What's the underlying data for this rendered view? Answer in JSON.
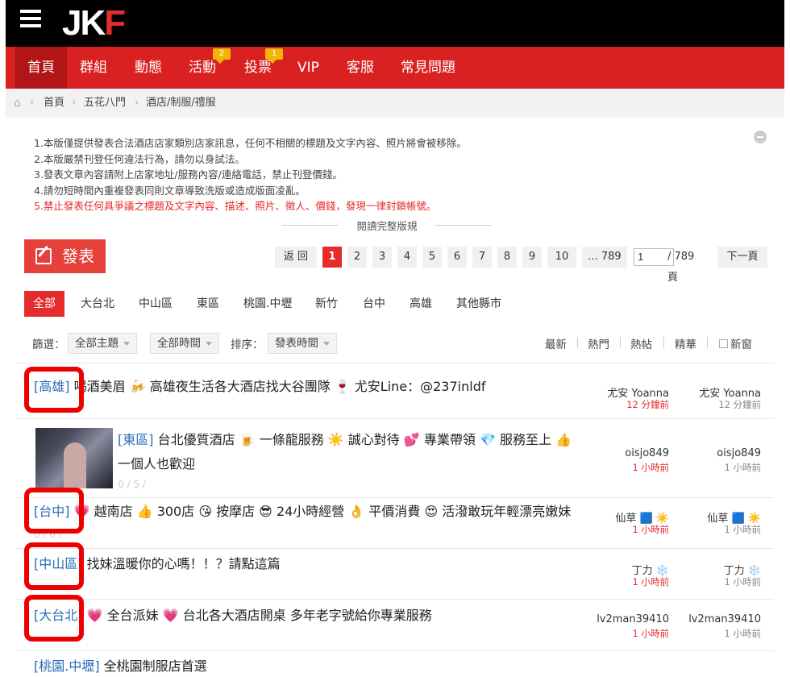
{
  "header": {
    "logo_main": "JK",
    "logo_accent": "F"
  },
  "nav": {
    "items": [
      {
        "label": "首頁",
        "active": true
      },
      {
        "label": "群組"
      },
      {
        "label": "動態"
      },
      {
        "label": "活動",
        "badge": "2"
      },
      {
        "label": "投票",
        "badge": "1"
      },
      {
        "label": "VIP"
      },
      {
        "label": "客服"
      },
      {
        "label": "常見問題"
      }
    ]
  },
  "breadcrumb": {
    "home_icon": "home-icon",
    "items": [
      "首頁",
      "五花八門",
      "酒店/制服/禮服"
    ]
  },
  "rules": {
    "lines": [
      "1.本版僅提供發表合法酒店店家類別店家訊息，任何不相關的標題及文字內容、照片將會被移除。",
      "2.本版嚴禁刊登任何違法行為，請勿以身試法。",
      "3.發表文章內容請附上店家地址/服務內容/連絡電話，禁止刊登價錢。",
      "4.請勿短時間內重複發表同則文章導致洗版或造成版面凌亂。",
      "5.禁止發表任何具爭議之標題及文字內容、描述、照片、徵人、價錢，發現一律封鎖帳號。"
    ],
    "read_full": "閱讀完整版規"
  },
  "post_button": {
    "label": "發表"
  },
  "pagination": {
    "back": "返 回",
    "pages": [
      "1",
      "2",
      "3",
      "4",
      "5",
      "6",
      "7",
      "8",
      "9",
      "10"
    ],
    "active": "1",
    "last": "... 789",
    "current_input": "1",
    "total": "/ 789 頁",
    "next": "下一頁"
  },
  "tabs": {
    "items": [
      "全部",
      "大台北",
      "中山區",
      "東區",
      "桃園.中壢",
      "新竹",
      "台中",
      "高雄",
      "其他縣市"
    ],
    "active": "全部"
  },
  "filters": {
    "filter_label": "篩選：",
    "topic": "全部主題",
    "time": "全部時間",
    "sort_label": "排序：",
    "sort": "發表時間",
    "right": [
      "最新",
      "熱門",
      "熱帖",
      "精華",
      "新窗"
    ]
  },
  "threads": [
    {
      "category": "[高雄]",
      "title": "喝酒美眉 🍻 高雄夜生活各大酒店找大谷團隊 🍷 尤安Line：@237inldf",
      "author": "尤安 Yoanna",
      "time": "12 分鐘前",
      "last_author": "尤安 Yoanna",
      "last_time": "12 分鐘前"
    },
    {
      "category": "[東區]",
      "title": "台北優質酒店 🍺 一條龍服務 ☀️ 誠心對待 💕 專業帶領 💎 服務至上 👍 一個人也歡迎",
      "stats": "0 / 5 /",
      "author": "oisjo849",
      "time": "1 小時前",
      "last_author": "oisjo849",
      "last_time": "1 小時前"
    },
    {
      "category": "[台中]",
      "title": "💗 越南店 👍 300店 😘 按摩店 😎 24小時經營 👌 平價消費 😍 活潑敢玩年輕漂亮嫩妹",
      "stats": "0 / 6 /",
      "author": "仙草 🟦 ☀️",
      "time": "1 小時前",
      "last_author": "仙草 🟦 ☀️",
      "last_time": "1 小時前"
    },
    {
      "category": "[中山區]",
      "title": "找妹溫暖你的心嗎！！？請點這篇",
      "author": "丁力 ❄️",
      "time": "1 小時前",
      "last_author": "丁力 ❄️",
      "last_time": "1 小時前"
    },
    {
      "category": "[大台北]",
      "title": "💗 全台派妹 💗 台北各大酒店開桌 多年老字號給你專業服務",
      "author": "lv2man39410",
      "time": "1 小時前",
      "last_author": "lv2man39410",
      "last_time": "1 小時前"
    },
    {
      "category": "[桃園.中壢]",
      "title": "全桃園制服店首選"
    }
  ],
  "colors": {
    "brand_red": "#d92121",
    "link_blue": "#2a6cb6",
    "highlight": "#ee0000"
  }
}
